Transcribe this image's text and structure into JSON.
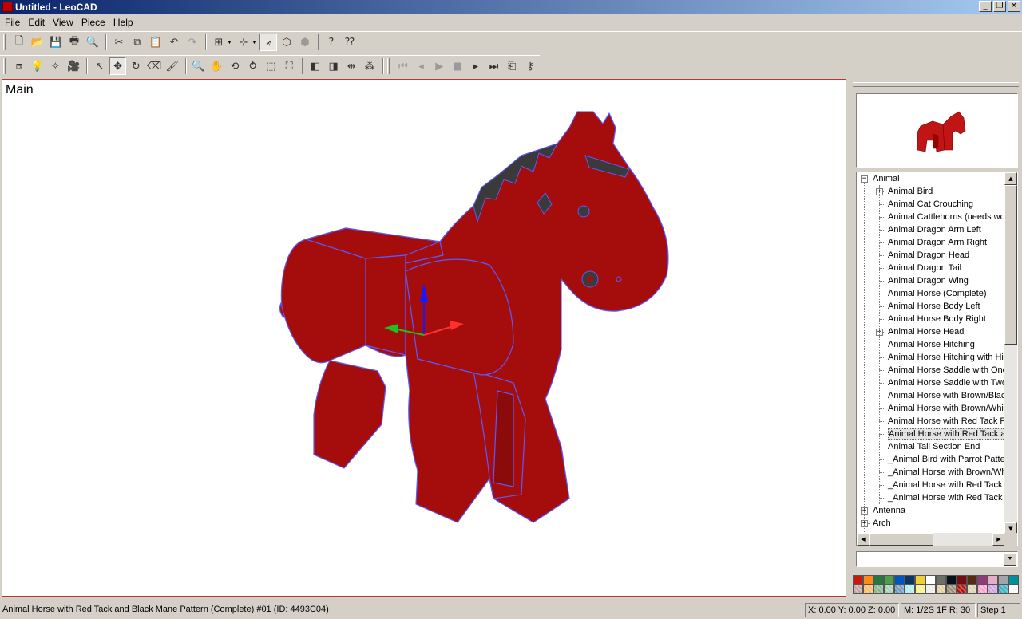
{
  "window": {
    "title": "Untitled - LeoCAD"
  },
  "menu": [
    "File",
    "Edit",
    "View",
    "Piece",
    "Help"
  ],
  "toolbar1": {
    "buttons": [
      {
        "name": "new-icon",
        "glyph": "🗋"
      },
      {
        "name": "open-icon",
        "glyph": "📂"
      },
      {
        "name": "save-icon",
        "glyph": "💾"
      },
      {
        "name": "print-icon",
        "glyph": "🖶"
      },
      {
        "name": "print-preview-icon",
        "glyph": "🔍"
      },
      {
        "name": "cut-icon",
        "glyph": "✂"
      },
      {
        "name": "copy-icon",
        "glyph": "⧉"
      },
      {
        "name": "paste-icon",
        "glyph": "📋"
      },
      {
        "name": "undo-icon",
        "glyph": "↶"
      },
      {
        "name": "redo-icon",
        "glyph": "↷"
      },
      {
        "name": "snap-icon",
        "glyph": "⊞"
      },
      {
        "name": "grid-snap-icon",
        "glyph": "⊹"
      },
      {
        "name": "angle-snap-icon",
        "glyph": "⦨"
      },
      {
        "name": "wireframe-icon",
        "glyph": "⬡"
      },
      {
        "name": "solid-box-icon",
        "glyph": "⬢"
      },
      {
        "name": "help-icon",
        "glyph": "?"
      },
      {
        "name": "context-help-icon",
        "glyph": "⁇"
      }
    ]
  },
  "toolbar2": {
    "buttons": [
      {
        "name": "insert-piece-icon",
        "glyph": "⧈"
      },
      {
        "name": "light-icon",
        "glyph": "💡"
      },
      {
        "name": "spotlight-icon",
        "glyph": "✧"
      },
      {
        "name": "camera-icon",
        "glyph": "🎥"
      },
      {
        "name": "select-icon",
        "glyph": "↖"
      },
      {
        "name": "move-icon",
        "glyph": "✥"
      },
      {
        "name": "rotate-icon",
        "glyph": "↻"
      },
      {
        "name": "erase-icon",
        "glyph": "⌫"
      },
      {
        "name": "paint-icon",
        "glyph": "🖌"
      },
      {
        "name": "zoom-icon",
        "glyph": "🔍"
      },
      {
        "name": "pan-icon",
        "glyph": "✋"
      },
      {
        "name": "rotate-view-icon",
        "glyph": "⟲"
      },
      {
        "name": "roll-icon",
        "glyph": "⥁"
      },
      {
        "name": "zoom-region-icon",
        "glyph": "⬚"
      },
      {
        "name": "zoom-extents-icon",
        "glyph": "⛶"
      },
      {
        "name": "previous-icon",
        "glyph": "◧"
      },
      {
        "name": "next-icon",
        "glyph": "◨"
      },
      {
        "name": "mirror-icon",
        "glyph": "⇹"
      },
      {
        "name": "array-icon",
        "glyph": "⁂"
      }
    ],
    "animation": [
      {
        "name": "first-frame-icon",
        "glyph": "⏮"
      },
      {
        "name": "prev-frame-icon",
        "glyph": "◂"
      },
      {
        "name": "play-icon",
        "glyph": "▶"
      },
      {
        "name": "stop-icon",
        "glyph": "■"
      },
      {
        "name": "next-frame-icon",
        "glyph": "▸"
      },
      {
        "name": "last-frame-icon",
        "glyph": "⏭"
      },
      {
        "name": "animation-mode-icon",
        "glyph": "⎗"
      },
      {
        "name": "add-keys-icon",
        "glyph": "⚷"
      }
    ]
  },
  "viewport": {
    "label": "Main",
    "model_color": "#a50d0d",
    "edge_color": "#5a5aff"
  },
  "piece_tree": {
    "items": [
      {
        "label": "Animal",
        "level": 0,
        "expander": "−"
      },
      {
        "label": "Animal Bird",
        "level": 1,
        "expander": "+"
      },
      {
        "label": "Animal Cat Crouching",
        "level": 1,
        "expander": ""
      },
      {
        "label": "Animal Cattlehorns (needs wor",
        "level": 1,
        "expander": ""
      },
      {
        "label": "Animal Dragon Arm Left",
        "level": 1,
        "expander": ""
      },
      {
        "label": "Animal Dragon Arm Right",
        "level": 1,
        "expander": ""
      },
      {
        "label": "Animal Dragon Head",
        "level": 1,
        "expander": ""
      },
      {
        "label": "Animal Dragon Tail",
        "level": 1,
        "expander": ""
      },
      {
        "label": "Animal Dragon Wing",
        "level": 1,
        "expander": ""
      },
      {
        "label": "Animal Horse (Complete)",
        "level": 1,
        "expander": ""
      },
      {
        "label": "Animal Horse Body Left",
        "level": 1,
        "expander": ""
      },
      {
        "label": "Animal Horse Body Right",
        "level": 1,
        "expander": ""
      },
      {
        "label": "Animal Horse Head",
        "level": 1,
        "expander": "+"
      },
      {
        "label": "Animal Horse Hitching",
        "level": 1,
        "expander": ""
      },
      {
        "label": "Animal Horse Hitching with Hin",
        "level": 1,
        "expander": ""
      },
      {
        "label": "Animal Horse Saddle with One",
        "level": 1,
        "expander": ""
      },
      {
        "label": "Animal Horse Saddle with Two",
        "level": 1,
        "expander": ""
      },
      {
        "label": "Animal Horse with Brown/Black",
        "level": 1,
        "expander": ""
      },
      {
        "label": "Animal Horse with Brown/Whit",
        "level": 1,
        "expander": ""
      },
      {
        "label": "Animal Horse with Red Tack Pa",
        "level": 1,
        "expander": ""
      },
      {
        "label": "Animal Horse with Red Tack an",
        "level": 1,
        "expander": "",
        "selected": true
      },
      {
        "label": "Animal Tail Section End",
        "level": 1,
        "expander": ""
      },
      {
        "label": "_Animal Bird with Parrot Patter",
        "level": 1,
        "expander": ""
      },
      {
        "label": "_Animal Horse with Brown/Whi",
        "level": 1,
        "expander": ""
      },
      {
        "label": "_Animal Horse with Red Tack P",
        "level": 1,
        "expander": ""
      },
      {
        "label": "_Animal Horse with Red Tack a",
        "level": 1,
        "expander": ""
      },
      {
        "label": "Antenna",
        "level": 0,
        "expander": "+"
      },
      {
        "label": "Arch",
        "level": 0,
        "expander": "+"
      }
    ]
  },
  "search": {
    "value": ""
  },
  "palette": [
    "#c91a09",
    "#fe8a18",
    "#237841",
    "#4b9f4a",
    "#0055bf",
    "#0a3463",
    "#f2cd37",
    "#ffffff",
    "#6c6e68",
    "#05131d",
    "#720e0f",
    "#582a12",
    "#923978",
    "#e4adc8",
    "#a0a5a9",
    "#008f9b",
    "#c9a0a0",
    "#f9ba61",
    "#84b68d",
    "#a3d2b0",
    "#6c96bf",
    "#aeefec",
    "#f8f184",
    "#eeeeee",
    "#e4cd9e",
    "#958a73",
    "#b31004",
    "#dfcfb5",
    "#ff9ecd",
    "#cda4de",
    "#36aebf",
    "#fcfcfc"
  ],
  "status": {
    "message": "Animal Horse with Red Tack and Black Mane Pattern (Complete) #01 (ID: 4493C04)",
    "coords": "X: 0.00 Y: 0.00 Z: 0.00",
    "snap": "M: 1/2S 1F R: 30",
    "step": "Step 1"
  }
}
